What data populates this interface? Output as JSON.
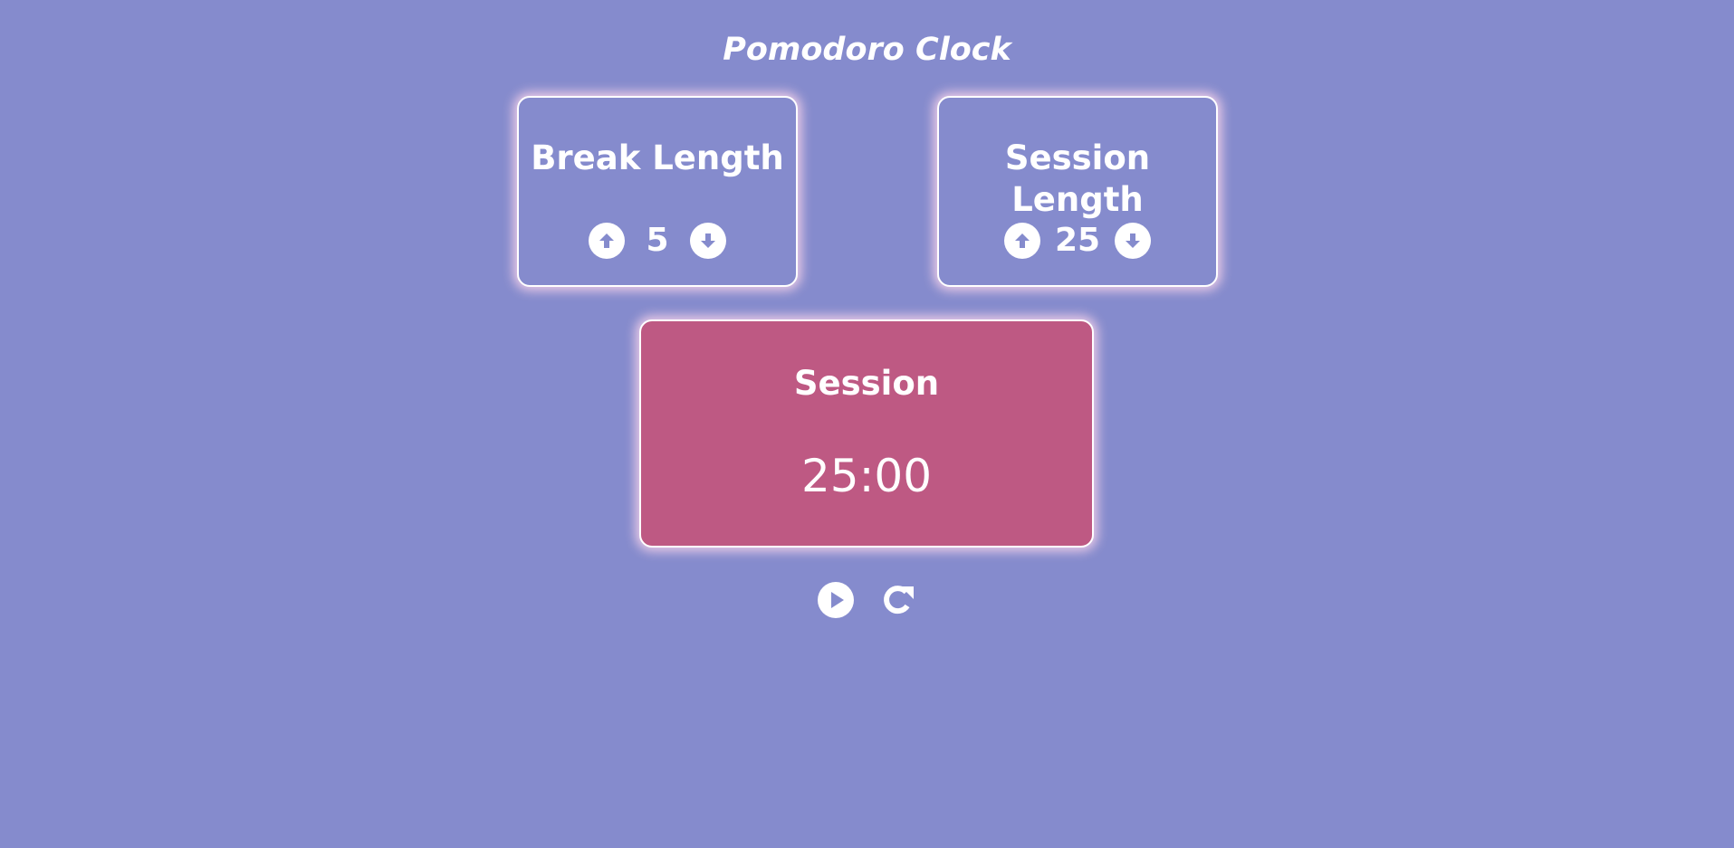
{
  "app": {
    "title": "Pomodoro Clock"
  },
  "break": {
    "label": "Break Length",
    "value": "5",
    "increment_icon": "arrow-circle-up-icon",
    "decrement_icon": "arrow-circle-down-icon"
  },
  "session": {
    "label": "Session Length",
    "value": "25",
    "increment_icon": "arrow-circle-up-icon",
    "decrement_icon": "arrow-circle-down-icon"
  },
  "timer": {
    "label": "Session",
    "time": "25:00"
  },
  "controls": {
    "play_icon": "play-circle-icon",
    "reset_icon": "redo-icon"
  },
  "colors": {
    "background": "#858bcd",
    "timer_panel": "#be5983",
    "text": "#ffffff",
    "panel_glow": "#ffd7eb"
  }
}
